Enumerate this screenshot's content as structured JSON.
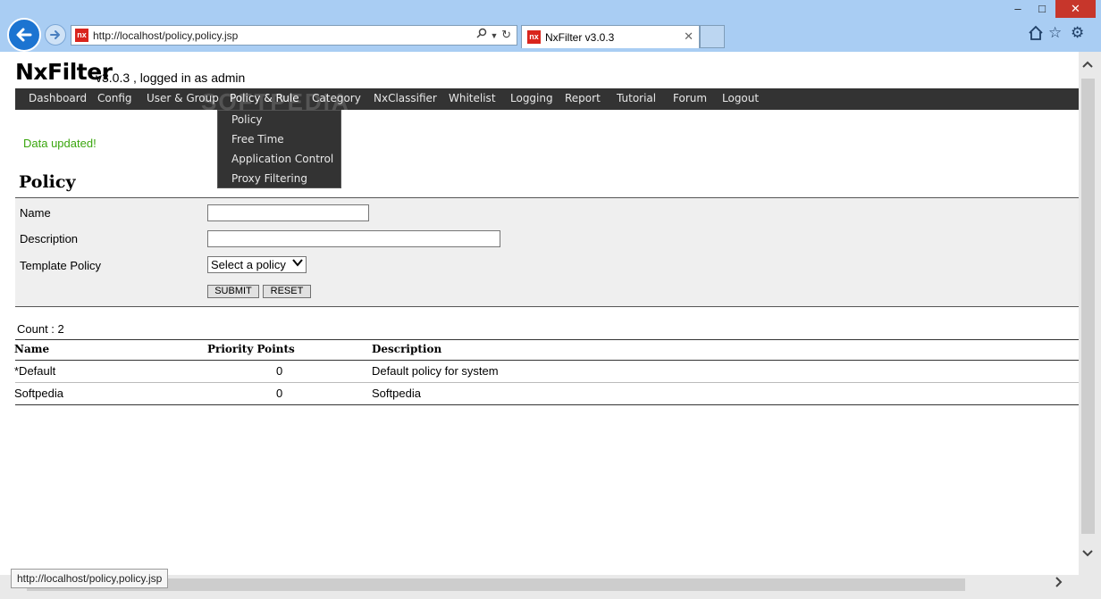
{
  "browser": {
    "url": "http://localhost/policy,policy.jsp",
    "tab_title": "NxFilter v3.0.3",
    "favicon_text": "nx",
    "window_controls": [
      "–",
      "□",
      "✕"
    ],
    "tool_icons": [
      "home-icon",
      "star-icon",
      "gear-icon"
    ],
    "status_url": "http://localhost/policy,policy.jsp"
  },
  "header": {
    "logo": "NxFilter",
    "version_text": "v3.0.3 , logged in as admin"
  },
  "nav": {
    "items": [
      {
        "label": "Dashboard"
      },
      {
        "label": "Config"
      },
      {
        "label": "User & Group"
      },
      {
        "label": "Policy & Rule"
      },
      {
        "label": "Category"
      },
      {
        "label": "NxClassifier"
      },
      {
        "label": "Whitelist"
      },
      {
        "label": "Logging"
      },
      {
        "label": "Report"
      },
      {
        "label": "Tutorial"
      },
      {
        "label": "Forum"
      },
      {
        "label": "Logout"
      }
    ],
    "dropdown": [
      {
        "label": "Policy"
      },
      {
        "label": "Free Time"
      },
      {
        "label": "Application Control"
      },
      {
        "label": "Proxy Filtering"
      }
    ]
  },
  "watermark": "SOFTPEDIA",
  "message": "Data updated!",
  "section_title": "Policy",
  "form": {
    "name_label": "Name",
    "name_value": "",
    "description_label": "Description",
    "description_value": "",
    "template_label": "Template Policy",
    "template_selected": "Select a policy",
    "submit_label": "SUBMIT",
    "reset_label": "RESET"
  },
  "list": {
    "count_text": "Count : 2",
    "columns": [
      "Name",
      "Priority Points",
      "Description"
    ],
    "rows": [
      {
        "name": "*Default",
        "priority": "0",
        "description": "Default policy for system"
      },
      {
        "name": "Softpedia",
        "priority": "0",
        "description": "Softpedia"
      }
    ]
  },
  "colors": {
    "menubar": "#333333",
    "message": "#3aa60e",
    "browser_frame": "#a9cdf3"
  }
}
